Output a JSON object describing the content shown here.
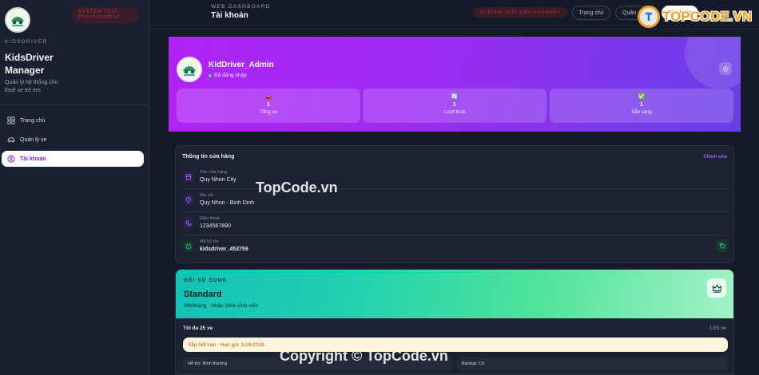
{
  "sidebar": {
    "env_badge": "SYSTEM TEST ENVIRONMENT",
    "brand_small": "KIDSDRIVER",
    "brand_title": "KidsDriver Manager",
    "brand_subtitle": "Quản lý hệ thống cho thuê xe trẻ em",
    "items": [
      {
        "label": "Trang chủ",
        "icon": "grid-icon",
        "active": false
      },
      {
        "label": "Quản lý xe",
        "icon": "car-icon",
        "active": false
      },
      {
        "label": "Tài khoản",
        "icon": "user-circle-icon",
        "active": true
      }
    ]
  },
  "header": {
    "small": "WEB DASHBOARD",
    "title": "Tài khoản",
    "env_badge": "SYSTEM TEST ENVIRONMENT",
    "nav": [
      "Trang chủ",
      "Quản",
      "Tài khoản"
    ]
  },
  "hero": {
    "name": "KidDriver_Admin",
    "status": "Đã đăng nhập",
    "stats": [
      {
        "icon": "car-emoji-icon",
        "value": "1",
        "label": "Tổng xe"
      },
      {
        "icon": "refresh-emoji-icon",
        "value": "1",
        "label": "Lượt thuê"
      },
      {
        "icon": "check-emoji-icon",
        "value": "1",
        "label": "Sẵn sàng"
      }
    ]
  },
  "store": {
    "title": "Thông tin cửa hàng",
    "edit_label": "Chỉnh sửa",
    "rows": [
      {
        "label": "Tên cửa hàng",
        "value": "Quy Nhon City",
        "icon": "store-icon"
      },
      {
        "label": "Địa chỉ",
        "value": "Quy Nhon - Binh Dinh",
        "icon": "location-pin-icon"
      },
      {
        "label": "Điện thoại",
        "value": "1234567890",
        "icon": "phone-icon"
      },
      {
        "label": "Mã hỗ trợ",
        "value": "kidsdriver_453759",
        "icon": "support-id-icon"
      }
    ]
  },
  "plan": {
    "small": "GÓI SỬ DỤNG",
    "name": "Standard",
    "price": "99k/tháng · Hoặc 180k vĩnh viễn",
    "limit": "Tối đa 25 xe",
    "count": "1/25 xe",
    "warning": "Sắp hết hạn · Hạn gói: 12/6/2026",
    "features": [
      "Hỗ trợ: Bình thường",
      "Backup: Có"
    ]
  },
  "watermarks": {
    "top": "TOPCODE.VN",
    "middle": "TopCode.vn",
    "bottom": "Copyright © TopCode.vn"
  },
  "colors": {
    "accent": "#a855f7",
    "hero_start": "#b024f5",
    "hero_end": "#6a3fe6",
    "plan_start": "#14c2b8",
    "plan_end": "#a5f1c8",
    "danger_badge": "#b0304a",
    "online": "#36e07a"
  }
}
